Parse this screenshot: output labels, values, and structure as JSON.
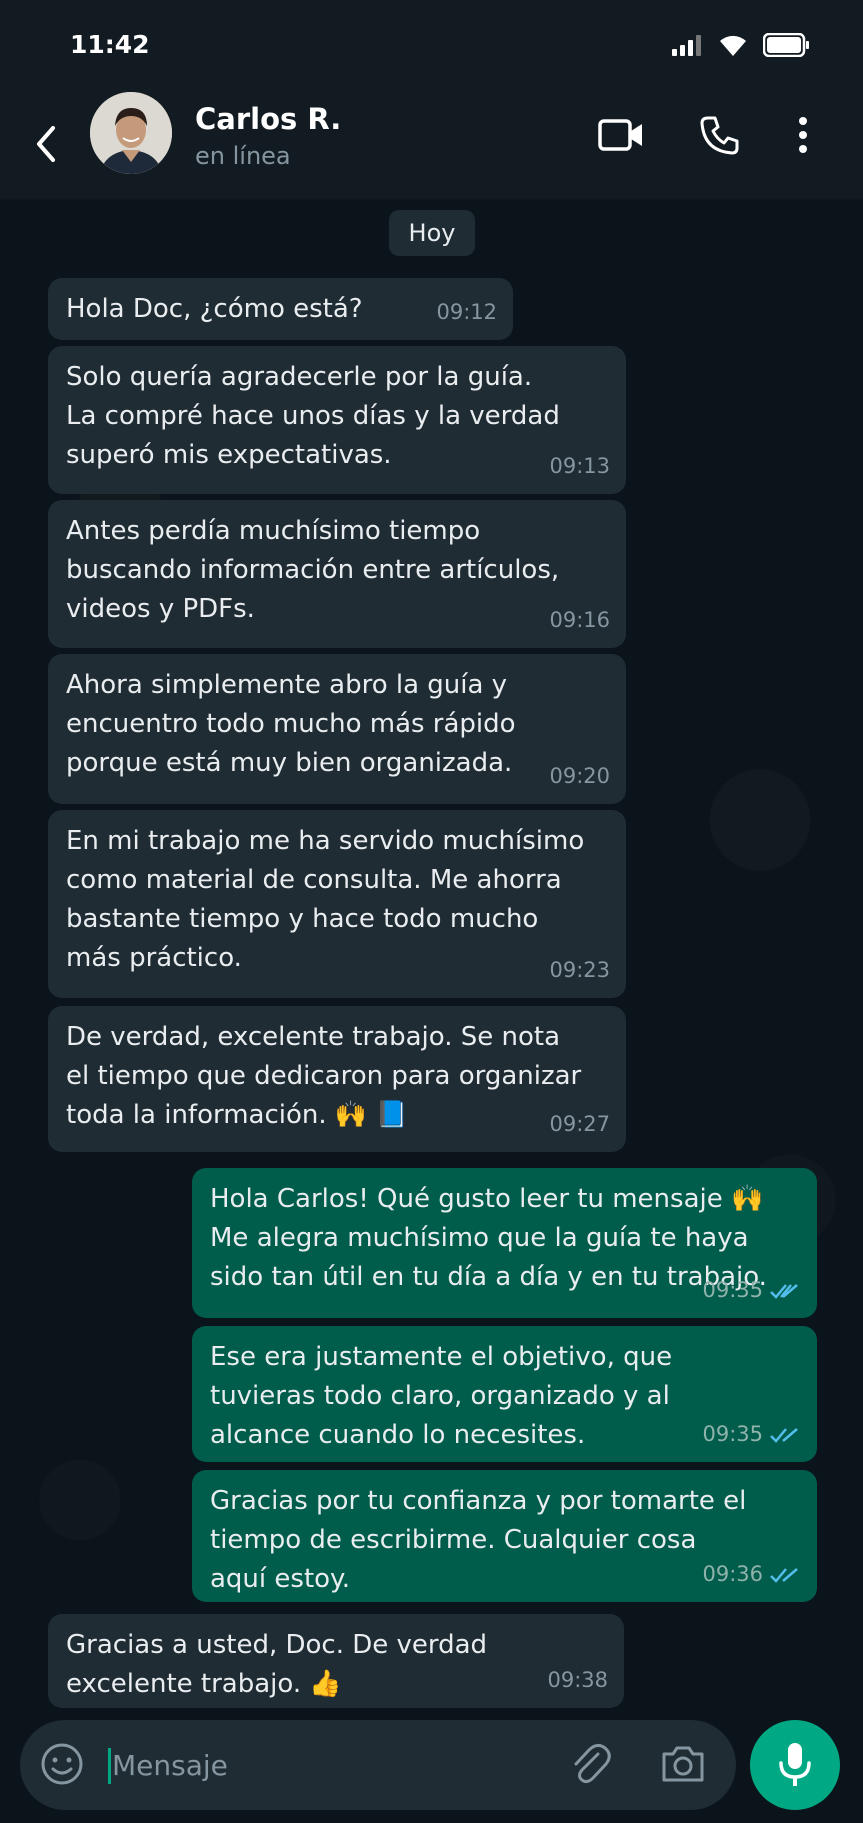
{
  "status_bar": {
    "time": "11:42"
  },
  "header": {
    "contact_name": "Carlos R.",
    "contact_status": "en línea"
  },
  "chat": {
    "date_label": "Hoy",
    "messages": [
      {
        "direction": "in",
        "text": "Hola Doc, ¿cómo está?",
        "time": "09:12"
      },
      {
        "direction": "in",
        "text": "Solo quería agradecerle por la guía.\nLa compré hace unos días y la verdad\nsuperó mis expectativas.",
        "time": "09:13"
      },
      {
        "direction": "in",
        "text": "Antes perdía muchísimo tiempo\nbuscando información entre artículos,\nvideos y PDFs.",
        "time": "09:16"
      },
      {
        "direction": "in",
        "text": "Ahora simplemente abro la guía y\nencuentro todo mucho más rápido\nporque está muy bien organizada.",
        "time": "09:20"
      },
      {
        "direction": "in",
        "text": "En mi trabajo me ha servido muchísimo\ncomo material de consulta. Me ahorra\nbastante tiempo y hace todo mucho\nmás práctico.",
        "time": "09:23"
      },
      {
        "direction": "in",
        "text": "De verdad, excelente trabajo. Se nota\nel tiempo que dedicaron para organizar\ntoda la información. 🙌 📘",
        "time": "09:27"
      },
      {
        "direction": "out",
        "text": "Hola Carlos! Qué gusto leer tu mensaje 🙌\nMe alegra muchísimo que la guía te haya\nsido tan útil en tu día a día y en tu trabajo.",
        "time": "09:35",
        "read": true
      },
      {
        "direction": "out",
        "text": "Ese era justamente el objetivo, que\ntuvieras todo claro, organizado y al\nalcance cuando lo necesites.",
        "time": "09:35",
        "read": true
      },
      {
        "direction": "out",
        "text": "Gracias por tu confianza y por tomarte el\ntiempo de escribirme. Cualquier cosa\naquí estoy.",
        "time": "09:36",
        "read": true
      },
      {
        "direction": "in",
        "text": "Gracias a usted, Doc. De verdad\nexcelente trabajo. 👍",
        "time": "09:38"
      }
    ]
  },
  "composer": {
    "placeholder": "Mensaje"
  },
  "colors": {
    "background": "#0b141a",
    "bar": "#121b22",
    "incoming_bubble": "#202c33",
    "outgoing_bubble": "#005c4b",
    "accent": "#00a884",
    "read_ticks": "#53bdeb"
  }
}
